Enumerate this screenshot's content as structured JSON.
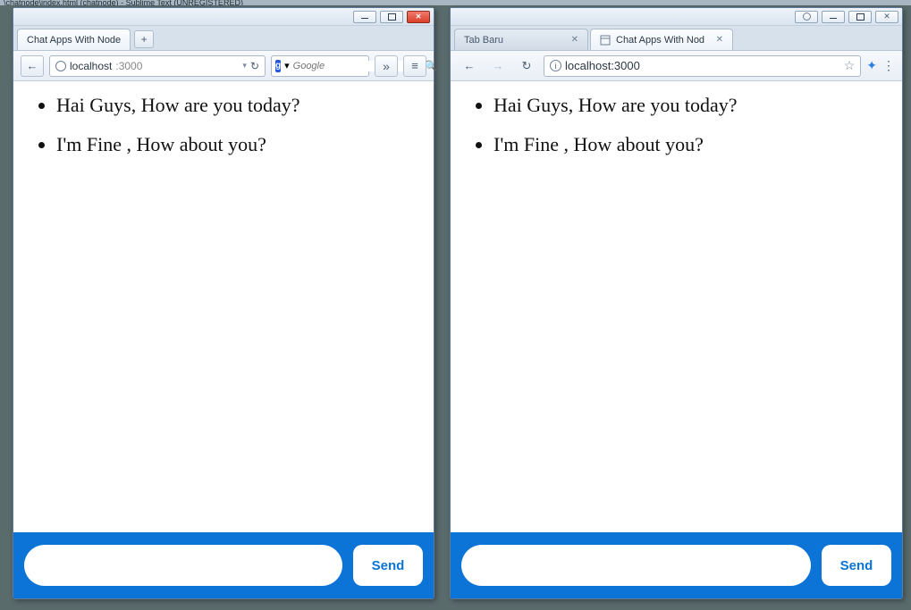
{
  "behind_title": "\\chatnode\\index.html (chatnode) - Sublime Text (UNREGISTERED)",
  "firefox": {
    "tab_title": "Chat Apps With Node",
    "url_host": "localhost",
    "url_port": ":3000",
    "search_placeholder": "Google",
    "messages": [
      "Hai Guys, How are you today?",
      "I'm Fine , How about you?"
    ],
    "send_label": "Send"
  },
  "chrome": {
    "tab1_title": "Tab Baru",
    "tab2_title": "Chat Apps With Nod",
    "url_display": "localhost:3000",
    "messages": [
      "Hai Guys, How are you today?",
      "I'm Fine , How about you?"
    ],
    "send_label": "Send"
  }
}
